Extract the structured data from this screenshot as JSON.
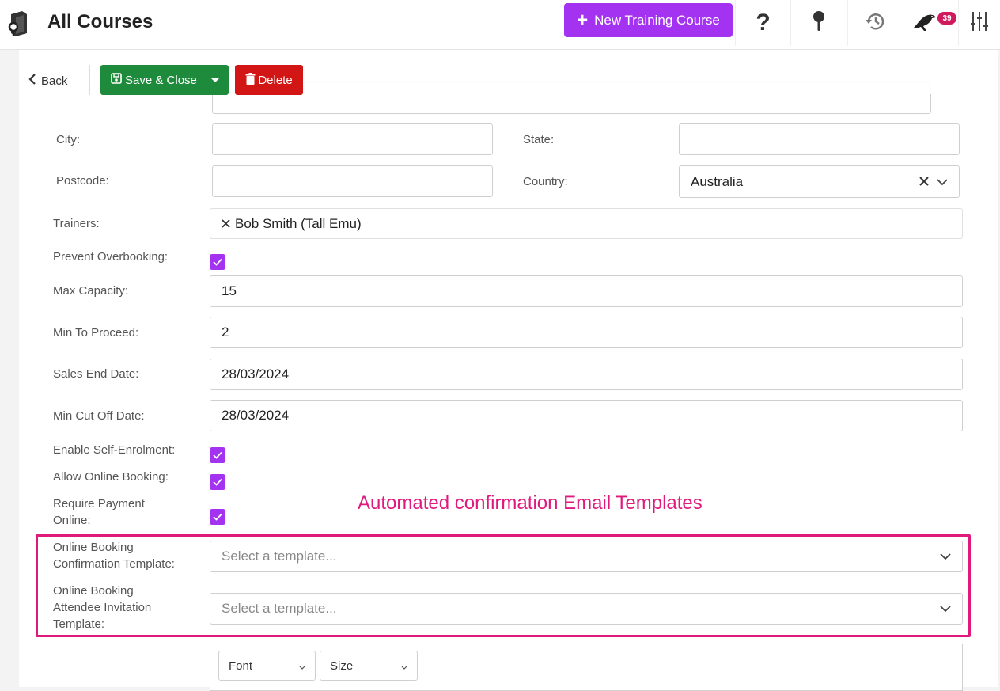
{
  "header": {
    "title": "All Courses",
    "new_course_label": "New Training Course",
    "notification_count": "39"
  },
  "toolbar": {
    "back_label": "Back",
    "save_close_label": "Save & Close",
    "delete_label": "Delete"
  },
  "form": {
    "city": {
      "label": "City:",
      "value": ""
    },
    "state": {
      "label": "State:",
      "value": ""
    },
    "postcode": {
      "label": "Postcode:",
      "value": ""
    },
    "country": {
      "label": "Country:",
      "value": "Australia"
    },
    "trainers": {
      "label": "Trainers:",
      "value": "Bob Smith (Tall Emu)"
    },
    "prevent_overbooking": {
      "label": "Prevent Overbooking:",
      "checked": true
    },
    "max_capacity": {
      "label": "Max Capacity:",
      "value": "15"
    },
    "min_to_proceed": {
      "label": "Min To Proceed:",
      "value": "2"
    },
    "sales_end_date": {
      "label": "Sales End Date:",
      "value": "28/03/2024"
    },
    "min_cut_off_date": {
      "label": "Min Cut Off Date:",
      "value": "28/03/2024"
    },
    "enable_self_enrolment": {
      "label": "Enable Self-Enrolment:",
      "checked": true
    },
    "allow_online_booking": {
      "label": "Allow Online Booking:",
      "checked": true
    },
    "require_payment_online": {
      "label_line1": "Require Payment",
      "label_line2": "Online:",
      "checked": true
    },
    "confirmation_template": {
      "label_line1": "Online Booking",
      "label_line2": "Confirmation Template:",
      "placeholder": "Select a template..."
    },
    "invitation_template": {
      "label_line1": "Online Booking",
      "label_line2": "Attendee Invitation",
      "label_line3": "Template:",
      "placeholder": "Select a template..."
    }
  },
  "annotation": {
    "text": "Automated confirmation Email Templates",
    "color": "#e0197d"
  },
  "editor": {
    "font_label": "Font",
    "size_label": "Size"
  },
  "colors": {
    "accent": "#a333f0",
    "save": "#1e8a3c",
    "delete": "#d21616",
    "badge": "#d1195e"
  }
}
